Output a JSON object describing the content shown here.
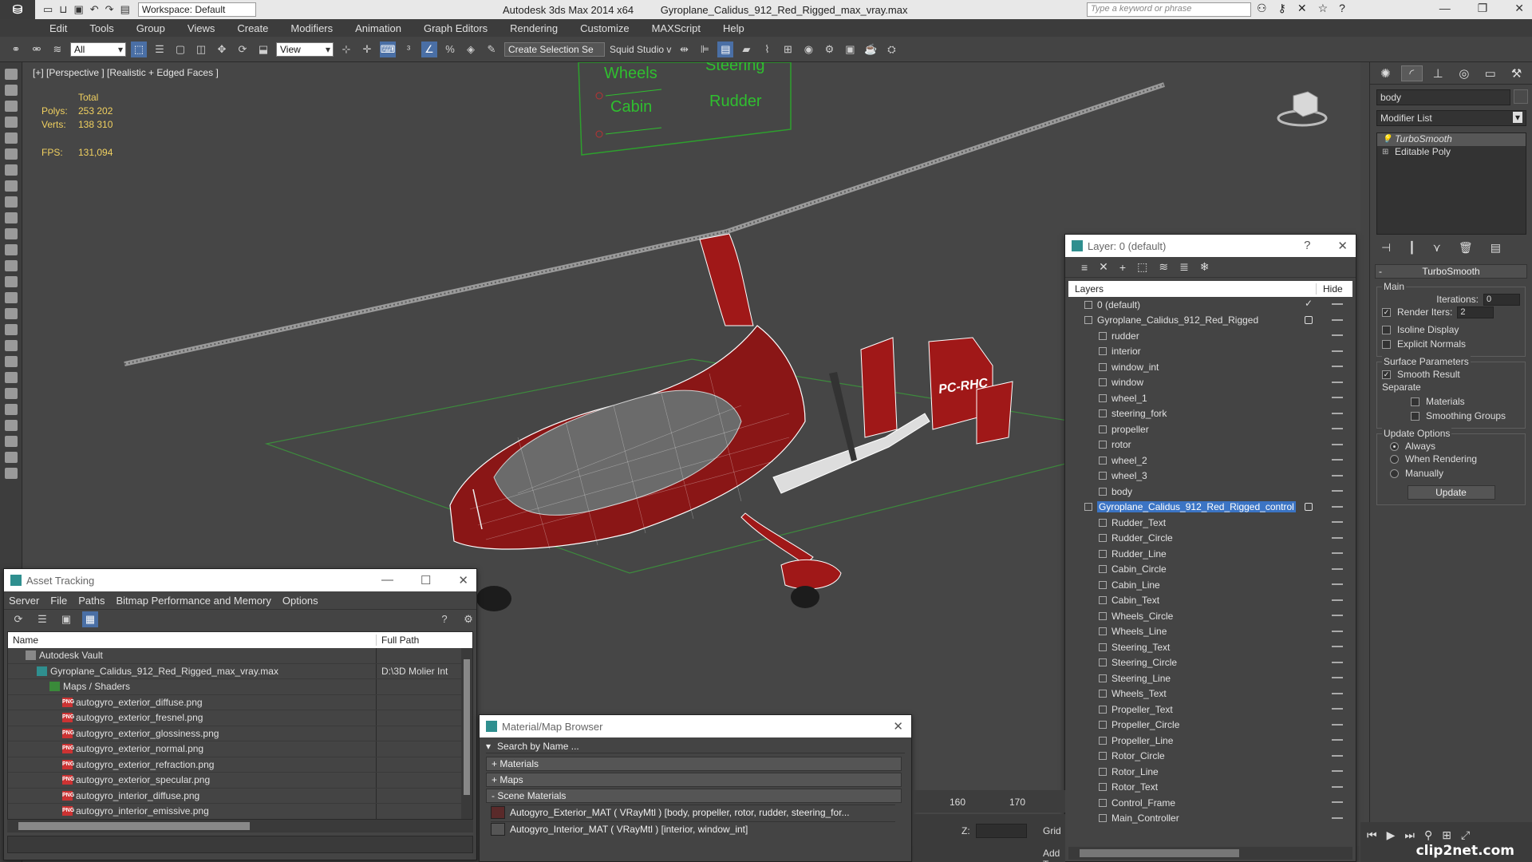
{
  "titlebar": {
    "workspace": "Workspace: Default",
    "app": "Autodesk 3ds Max  2014 x64",
    "file": "Gyroplane_Calidus_912_Red_Rigged_max_vray.max",
    "search_placeholder": "Type a keyword or phrase"
  },
  "menu": [
    "Edit",
    "Tools",
    "Group",
    "Views",
    "Create",
    "Modifiers",
    "Animation",
    "Graph Editors",
    "Rendering",
    "Customize",
    "MAXScript",
    "Help"
  ],
  "toolbar": {
    "filter": "All",
    "ref_coord": "View",
    "selection_set_placeholder": "Create Selection Se",
    "studio": "Squid Studio v"
  },
  "viewport": {
    "label": "[+] [Perspective ] [Realistic + Edged Faces ]",
    "stats_header": "Total",
    "polys_label": "Polys:",
    "polys": "253 202",
    "verts_label": "Verts:",
    "verts": "138 310",
    "fps_label": "FPS:",
    "fps": "131,094",
    "control_labels": [
      "Wheels",
      "Steering",
      "Cabin",
      "Rudder"
    ],
    "tail_text": "PC-RHC"
  },
  "command_panel": {
    "object_name": "body",
    "modifier_list": "Modifier List",
    "stack": [
      "TurboSmooth",
      "Editable Poly"
    ],
    "rollout": "TurboSmooth",
    "main_label": "Main",
    "iterations_label": "Iterations:",
    "iterations": "0",
    "render_iters_label": "Render Iters:",
    "render_iters": "2",
    "isoline": "Isoline Display",
    "explicit_normals": "Explicit Normals",
    "surface_params": "Surface Parameters",
    "smooth_result": "Smooth Result",
    "separate": "Separate",
    "materials": "Materials",
    "smoothing_groups": "Smoothing Groups",
    "update_options": "Update Options",
    "always": "Always",
    "when_rendering": "When Rendering",
    "manually": "Manually",
    "update_button": "Update"
  },
  "layer_window": {
    "title": "Layer: 0 (default)",
    "help": "?",
    "col_layers": "Layers",
    "col_hide": "Hide",
    "rows": [
      {
        "name": "0 (default)",
        "level": 1
      },
      {
        "name": "Gyroplane_Calidus_912_Red_Rigged",
        "level": 1
      },
      {
        "name": "rudder",
        "level": 2
      },
      {
        "name": "interior",
        "level": 2
      },
      {
        "name": "window_int",
        "level": 2
      },
      {
        "name": "window",
        "level": 2
      },
      {
        "name": "wheel_1",
        "level": 2
      },
      {
        "name": "steering_fork",
        "level": 2
      },
      {
        "name": "propeller",
        "level": 2
      },
      {
        "name": "rotor",
        "level": 2
      },
      {
        "name": "wheel_2",
        "level": 2
      },
      {
        "name": "wheel_3",
        "level": 2
      },
      {
        "name": "body",
        "level": 2
      },
      {
        "name": "Gyroplane_Calidus_912_Red_Rigged_control",
        "level": 1
      },
      {
        "name": "Rudder_Text",
        "level": 2
      },
      {
        "name": "Rudder_Circle",
        "level": 2
      },
      {
        "name": "Rudder_Line",
        "level": 2
      },
      {
        "name": "Cabin_Circle",
        "level": 2
      },
      {
        "name": "Cabin_Line",
        "level": 2
      },
      {
        "name": "Cabin_Text",
        "level": 2
      },
      {
        "name": "Wheels_Circle",
        "level": 2
      },
      {
        "name": "Wheels_Line",
        "level": 2
      },
      {
        "name": "Steering_Text",
        "level": 2
      },
      {
        "name": "Steering_Circle",
        "level": 2
      },
      {
        "name": "Steering_Line",
        "level": 2
      },
      {
        "name": "Wheels_Text",
        "level": 2
      },
      {
        "name": "Propeller_Text",
        "level": 2
      },
      {
        "name": "Propeller_Circle",
        "level": 2
      },
      {
        "name": "Propeller_Line",
        "level": 2
      },
      {
        "name": "Rotor_Circle",
        "level": 2
      },
      {
        "name": "Rotor_Line",
        "level": 2
      },
      {
        "name": "Rotor_Text",
        "level": 2
      },
      {
        "name": "Control_Frame",
        "level": 2
      },
      {
        "name": "Main_Controller",
        "level": 2
      }
    ]
  },
  "asset_window": {
    "title": "Asset Tracking",
    "menu": [
      "Server",
      "File",
      "Paths",
      "Bitmap Performance and Memory",
      "Options"
    ],
    "col_name": "Name",
    "col_path": "Full Path",
    "rows": [
      {
        "name": "Autodesk Vault",
        "path": ""
      },
      {
        "name": "Gyroplane_Calidus_912_Red_Rigged_max_vray.max",
        "path": "D:\\3D Molier Int"
      },
      {
        "name": "Maps / Shaders",
        "path": ""
      },
      {
        "name": "autogyro_exterior_diffuse.png",
        "path": ""
      },
      {
        "name": "autogyro_exterior_fresnel.png",
        "path": ""
      },
      {
        "name": "autogyro_exterior_glossiness.png",
        "path": ""
      },
      {
        "name": "autogyro_exterior_normal.png",
        "path": ""
      },
      {
        "name": "autogyro_exterior_refraction.png",
        "path": ""
      },
      {
        "name": "autogyro_exterior_specular.png",
        "path": ""
      },
      {
        "name": "autogyro_interior_diffuse.png",
        "path": ""
      },
      {
        "name": "autogyro_interior_emissive.png",
        "path": ""
      }
    ]
  },
  "material_window": {
    "title": "Material/Map Browser",
    "search": "Search by Name ...",
    "sections": [
      "+ Materials",
      "+ Maps",
      "- Scene Materials"
    ],
    "items": [
      "Autogyro_Exterior_MAT ( VRayMtl ) [body, propeller, rotor, rudder, steering_for...",
      "Autogyro_Interior_MAT ( VRayMtl ) [interior, window_int]"
    ]
  },
  "timeline": {
    "t160": "160",
    "t170": "170",
    "z_label": "Z:",
    "grid": "Grid",
    "add_t": "Add T"
  },
  "watermark": "clip2net.com",
  "colors": {
    "accent": "#3b74c4",
    "wire_red": "#b22222",
    "stats": "#f0d060"
  }
}
